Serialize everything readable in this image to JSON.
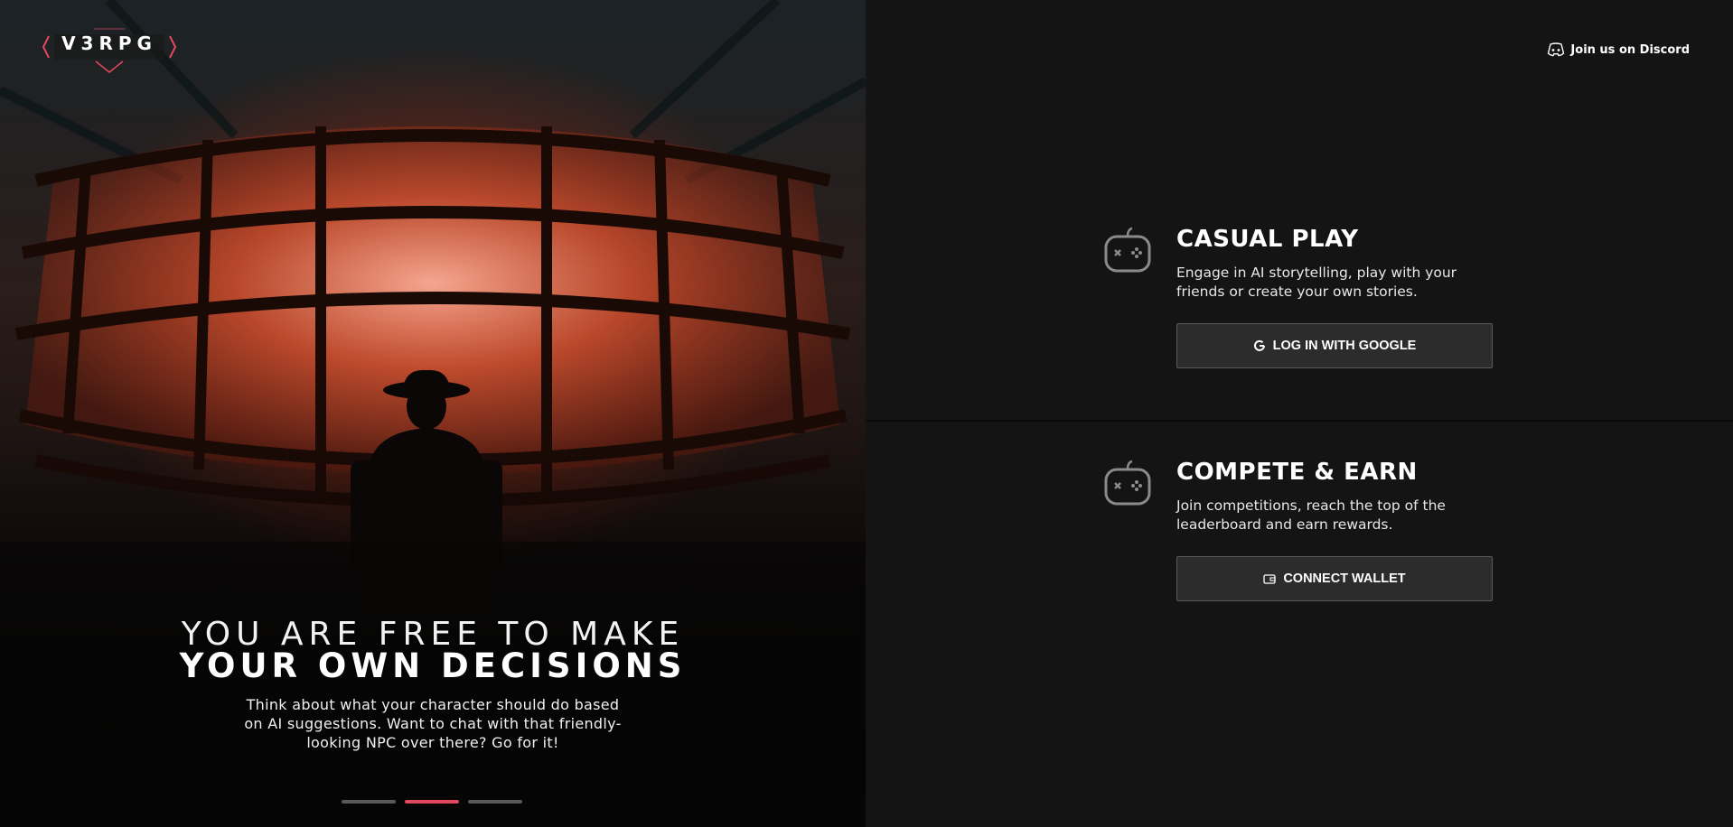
{
  "brand": {
    "logo_text": "V3RPG",
    "accent": "#e2485e"
  },
  "hero": {
    "headline_light": "YOU ARE FREE TO MAKE",
    "headline_bold": "YOUR OWN DECISIONS",
    "description": "Think about what your character should do based on AI suggestions. Want to chat with that friendly-looking NPC over there? Go for it!",
    "carousel": {
      "slide_count": 3,
      "active_index": 1
    }
  },
  "header": {
    "discord_label": "Join us on Discord",
    "discord_icon": "discord-icon"
  },
  "cards": [
    {
      "title": "CASUAL PLAY",
      "description": "Engage in AI storytelling, play with your friends or create your own stories.",
      "icon": "gamepad-icon",
      "button_label": "LOG IN WITH GOOGLE",
      "button_icon": "google-icon"
    },
    {
      "title": "COMPETE & EARN",
      "description": "Join competitions, reach the top of the leaderboard and earn rewards.",
      "icon": "gamepad-icon",
      "button_label": "CONNECT WALLET",
      "button_icon": "wallet-icon"
    }
  ]
}
